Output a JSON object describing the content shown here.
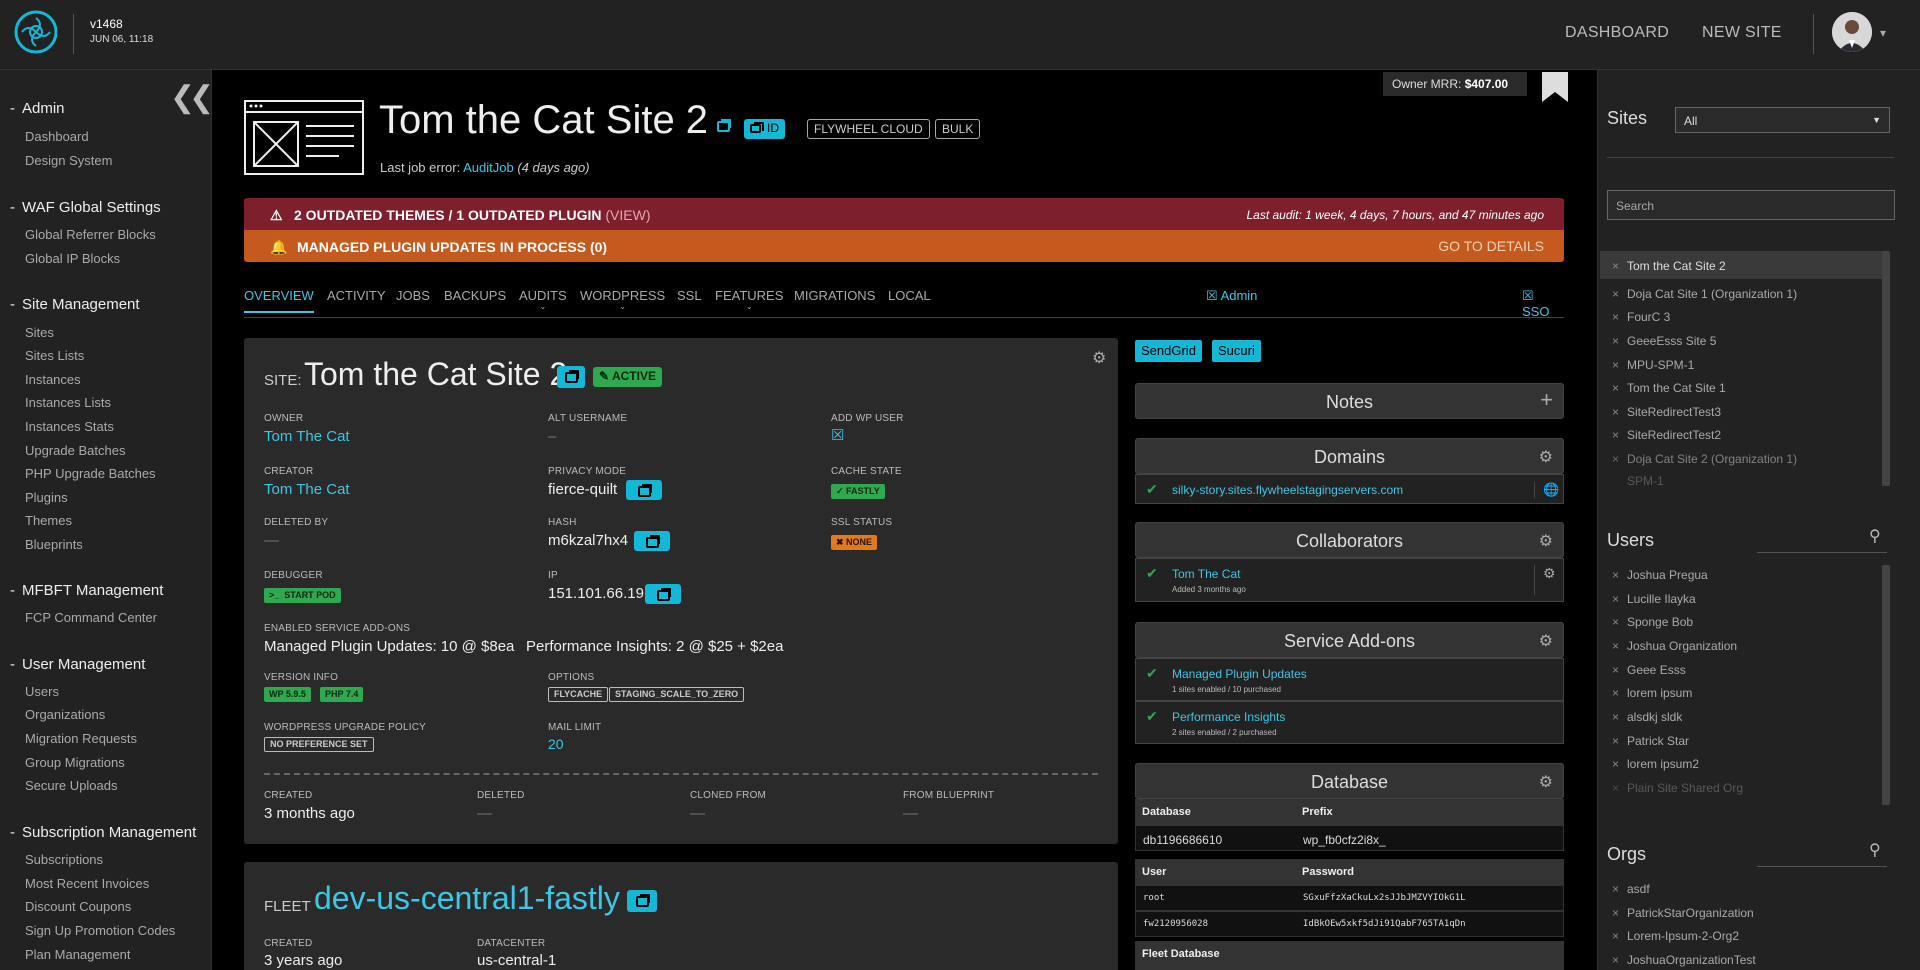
{
  "header": {
    "version": "v1468",
    "date": "JUN 06, 11:18",
    "nav": [
      "DASHBOARD",
      "NEW SITE"
    ]
  },
  "sidebar": {
    "sections": [
      {
        "title": "Admin",
        "items": [
          "Dashboard",
          "Design System"
        ]
      },
      {
        "title": "WAF Global Settings",
        "items": [
          "Global Referrer Blocks",
          "Global IP Blocks"
        ]
      },
      {
        "title": "Site Management",
        "items": [
          "Sites",
          "Sites Lists",
          "Instances",
          "Instances Lists",
          "Instances Stats",
          "Upgrade Batches",
          "PHP Upgrade Batches",
          "Plugins",
          "Themes",
          "Blueprints"
        ]
      },
      {
        "title": "MFBFT Management",
        "items": [
          "FCP Command Center"
        ]
      },
      {
        "title": "User Management",
        "items": [
          "Users",
          "Organizations",
          "Migration Requests",
          "Group Migrations",
          "Secure Uploads"
        ]
      },
      {
        "title": "Subscription Management",
        "items": [
          "Subscriptions",
          "Most Recent Invoices",
          "Discount Coupons",
          "Sign Up Promotion Codes",
          "Plan Management"
        ]
      }
    ]
  },
  "page": {
    "mrr_label": "Owner MRR:",
    "mrr_value": "$407.00",
    "title": "Tom the Cat Site 2",
    "badges": [
      "ID",
      "FLYWHEEL CLOUD",
      "BULK"
    ],
    "last_job_label": "Last job error:",
    "last_job_link": "AuditJob",
    "last_job_time": "(4 days ago)"
  },
  "alerts": {
    "outdated": "2 OUTDATED THEMES / 1 OUTDATED PLUGIN",
    "view": "(VIEW)",
    "last_audit": "Last audit: 1 week, 4 days, 7 hours, and 47 minutes ago",
    "managed": "MANAGED PLUGIN UPDATES IN PROCESS (0)",
    "details": "GO TO DETAILS"
  },
  "tabs": [
    "OVERVIEW",
    "ACTIVITY",
    "JOBS",
    "BACKUPS",
    "AUDITS",
    "WORDPRESS",
    "SSL",
    "FEATURES",
    "MIGRATIONS",
    "LOCAL"
  ],
  "tabs_right": {
    "admin": "Admin",
    "sso": "SSO"
  },
  "site": {
    "prefix": "SITE:",
    "name": "Tom the Cat Site 2",
    "status": "ACTIVE",
    "owner_label": "OWNER",
    "owner": "Tom The Cat",
    "alt_label": "ALT USERNAME",
    "alt": "–",
    "addwp_label": "ADD WP USER",
    "creator_label": "CREATOR",
    "creator": "Tom The Cat",
    "privacy_label": "PRIVACY MODE",
    "privacy": "fierce-quilt",
    "cache_label": "CACHE STATE",
    "cache": "FASTLY",
    "deleted_by_label": "DELETED BY",
    "deleted_by": "—",
    "hash_label": "HASH",
    "hash": "m6kzal7hx4",
    "ssl_label": "SSL STATUS",
    "ssl": "NONE",
    "debugger_label": "DEBUGGER",
    "debugger": "START POD",
    "ip_label": "IP",
    "ip": "151.101.66.19",
    "addons_label": "ENABLED SERVICE ADD-ONS",
    "addon1": "Managed Plugin Updates: 10 @ $8ea",
    "addon2": "Performance Insights: 2 @ $25 + $2ea",
    "version_label": "VERSION INFO",
    "wp": "WP 5.9.5",
    "php": "PHP 7.4",
    "options_label": "OPTIONS",
    "opt1": "FLYCACHE",
    "opt2": "STAGING_SCALE_TO_ZERO",
    "policy_label": "WORDPRESS UPGRADE POLICY",
    "policy": "NO PREFERENCE SET",
    "mail_label": "MAIL LIMIT",
    "mail": "20",
    "created_label": "CREATED",
    "created": "3 months ago",
    "deleted_label": "DELETED",
    "deleted": "—",
    "cloned_label": "CLONED FROM",
    "cloned": "—",
    "blueprint_label": "FROM BLUEPRINT",
    "blueprint": "—"
  },
  "fleet": {
    "prefix": "FLEET",
    "name": "dev-us-central1-fastly",
    "created_label": "CREATED",
    "created": "3 years ago",
    "dc_label": "DATACENTER",
    "dc": "us-central-1"
  },
  "panels": {
    "buttons": [
      "SendGrid",
      "Sucuri"
    ],
    "notes": "Notes",
    "domains": "Domains",
    "domain": "silky-story.sites.flywheelstagingservers.com",
    "collaborators": "Collaborators",
    "collab_name": "Tom The Cat",
    "collab_sub": "Added 3 months ago",
    "addons": "Service Add-ons",
    "addon1": "Managed Plugin Updates",
    "addon1_sub": "1 sites enabled / 10 purchased",
    "addon2": "Performance Insights",
    "addon2_sub": "2 sites enabled / 2 purchased",
    "database": "Database",
    "db_col1": "Database",
    "db_col2": "Prefix",
    "db_name": "db1196686610",
    "db_prefix": "wp_fb0cfz2i8x_",
    "user_col": "User",
    "pass_col": "Password",
    "user1": "root",
    "pass1": "SGxuFfzXaCkuLx2sJJbJMZVYIOkG1L",
    "user2": "fw2120956028",
    "pass2": "IdBkOEw5xkf5dJi91QabF765TA1qDn",
    "fleet_db": "Fleet Database"
  },
  "right": {
    "sites_title": "Sites",
    "sites_filter": "All",
    "search_placeholder": "Search",
    "sites": [
      "Tom the Cat Site 2",
      "Doja Cat Site 1 (Organization 1)",
      "FourC 3",
      "GeeeEsss Site 5",
      "MPU-SPM-1",
      "Tom the Cat Site 1",
      "SiteRedirectTest3",
      "SiteRedirectTest2",
      "Doja Cat Site 2 (Organization 1)",
      "SPM-1"
    ],
    "users_title": "Users",
    "users": [
      "Joshua Pregua",
      "Lucille Ilayka",
      "Sponge Bob",
      "Joshua Organization",
      "Geee Esss",
      "lorem ipsum",
      "alsdkj sldk",
      "Patrick Star",
      "lorem ipsum2",
      "Plain Site Shared Org"
    ],
    "orgs_title": "Orgs",
    "orgs": [
      "asdf",
      "PatrickStarOrganization",
      "Lorem-Ipsum-2-Org2",
      "JoshuaOrganizationTest"
    ]
  }
}
